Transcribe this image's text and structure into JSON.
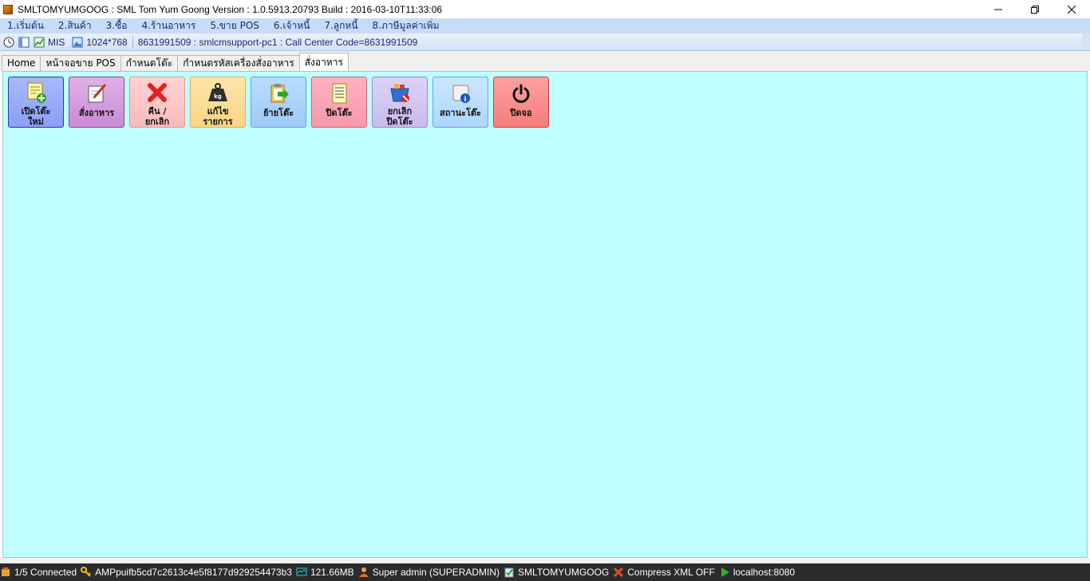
{
  "window": {
    "title": "SMLTOMYUMGOOG : SML Tom Yum Goong Version : 1.0.5913.20793  Build : 2016-03-10T11:33:06"
  },
  "menu": {
    "items": [
      {
        "label": "1.เริ่มต้น"
      },
      {
        "label": "2.สินค้า"
      },
      {
        "label": "3.ซื้อ"
      },
      {
        "label": "4.ร้านอาหาร"
      },
      {
        "label": "5.ขาย POS"
      },
      {
        "label": "6.เจ้าหนี้"
      },
      {
        "label": "7.ลูกหนี้"
      },
      {
        "label": "8.ภาษีมูลค่าเพิ่ม"
      }
    ]
  },
  "toolbar": {
    "mis_label": "MIS",
    "resolution": "1024*768",
    "info": "8631991509 : smlcmsupport-pc1 : Call Center Code=8631991509"
  },
  "tabs": [
    {
      "label": "Home"
    },
    {
      "label": "หน้าจอขาย POS"
    },
    {
      "label": "กำหนดโต๊ะ"
    },
    {
      "label": "กำหนดรหัสเครื่องสั่งอาหาร"
    },
    {
      "label": "สั่งอาหาร"
    }
  ],
  "actions": [
    {
      "label": "เปิดโต๊ะ\nใหม่",
      "icon": "note-add-icon",
      "color": "#8aa0f4"
    },
    {
      "label": "สั่งอาหาร",
      "icon": "pencil-paper-icon",
      "color": "#c98ad3"
    },
    {
      "label": "คืน /\nยกเลิก",
      "icon": "red-x-icon",
      "color": "#f7bcbc"
    },
    {
      "label": "แก้ไข\nรายการ",
      "icon": "weight-icon",
      "color": "#f8d488"
    },
    {
      "label": "ย้ายโต๊ะ",
      "icon": "clipboard-arrow-icon",
      "color": "#9fcaf5"
    },
    {
      "label": "ปิดโต๊ะ",
      "icon": "document-list-icon",
      "color": "#f598ab"
    },
    {
      "label": "ยกเลิก\nปิดโต๊ะ",
      "icon": "basket-cancel-icon",
      "color": "#c8bcee"
    },
    {
      "label": "สถานะโต๊ะ",
      "icon": "info-scroll-icon",
      "color": "#acd6fa"
    },
    {
      "label": "ปิดจอ",
      "icon": "power-icon",
      "color": "#f47d7d"
    }
  ],
  "status": {
    "connected": "1/5 Connected",
    "key": "AMPpuifb5cd7c2613c4e5f8177d929254473b3",
    "memory": "121.66MB",
    "user": "Super admin (SUPERADMIN)",
    "db": "SMLTOMYUMGOOG",
    "compress": "Compress XML OFF",
    "server": "localhost:8080"
  }
}
